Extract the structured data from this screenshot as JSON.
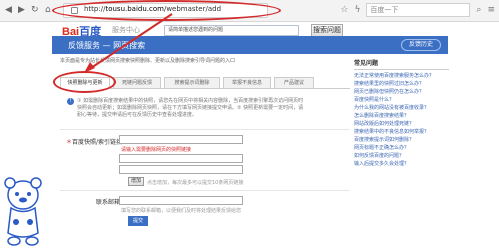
{
  "browser": {
    "back_icon": "back-arrow-icon",
    "forward_icon": "forward-arrow-icon",
    "refresh_icon": "refresh-icon",
    "home_icon": "home-icon",
    "url_scheme": "http://",
    "url_host": "tousu.baidu.com",
    "url_path": "/webmaster/add",
    "search_placeholder": "百度一下",
    "menu_icon": "menu-icon"
  },
  "site": {
    "logo_bai": "Bai",
    "logo_du": "百度",
    "service_name": "服务中心",
    "search_value": "请简单描述您遇到的问题",
    "search_button": "搜索问题"
  },
  "banner": {
    "title": "反馈服务 — 网页搜索",
    "history_button": "反馈历史"
  },
  "notice": "本页面是专为站长反馈网页搜索快照删除、更新以及删除搜索引导词问题的入口",
  "tabs": [
    {
      "label": "快照删除与更新"
    },
    {
      "label": "死链问题反馈"
    },
    {
      "label": "搜索提示词删除"
    },
    {
      "label": "举报不良信息"
    },
    {
      "label": "产品建议"
    }
  ],
  "instructions": {
    "icon": "info-icon",
    "text": "① 如需删除百度搜索结果中的快照，请您先在网页中将相关内容删除，当百度搜索引擎再次访问网页时快照会自动更新；如需删除网页快照，请在下方填写网页链接提交申请。② 快照更新需要一定时间，请耐心等待，提交申请后可在反馈历史中查看处理进度。"
  },
  "form": {
    "url_label_required": "＊",
    "url_label": "百度快照/索引链接：",
    "url_error": "请输入需要删除网页的快照链接",
    "add_button": "增加",
    "add_hint": "点击增加，每次最多可以提交10条网页链接",
    "email_label": "联系邮箱：",
    "email_hint": "填写您的联系邮箱，以便我们及时将处理结果反馈给您",
    "submit_button": "提交"
  },
  "faq": {
    "title": "常见问题",
    "items": [
      "无法正常使用百度搜索服务怎么办？",
      "搜索结果里的快照过旧怎么办？",
      "网页已删除但快照仍在怎么办？",
      "百度快照是什么？",
      "为什么我的网站没有被百度收录？",
      "怎么删除百度搜索结果？",
      "网站改版后如何处理死链？",
      "搜索结果中的不良信息如何举报？",
      "百度搜索提示词如何删除？",
      "网页标题不正确怎么办？",
      "如何反馈百度的问题？",
      "输入后提交多久会处理？"
    ]
  },
  "mascot": "baidu-bear-mascot"
}
